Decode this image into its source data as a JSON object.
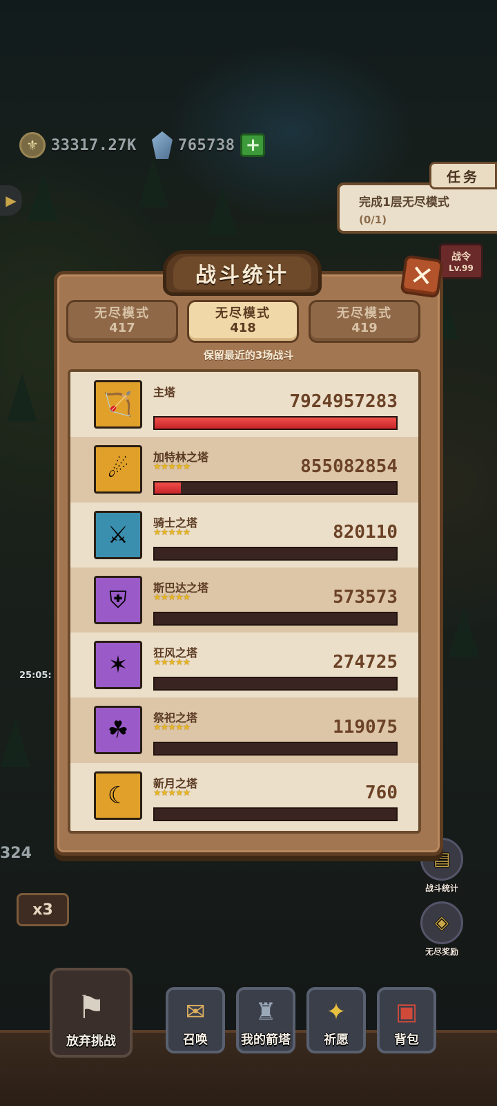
{
  "resources": {
    "gold_value": "33317.27K",
    "gem_value": "765738",
    "gold_icon": "coin-icon",
    "gem_icon": "gem-icon",
    "plus_label": "+"
  },
  "quest": {
    "tab_label": "任务",
    "title": "完成1层无尽模式",
    "progress": "(0/1)"
  },
  "battle_pass": {
    "label": "战令",
    "level": "Lv.99"
  },
  "modal": {
    "title": "战斗统计",
    "close_label": "✕",
    "note": "保留最近的3场战斗",
    "tabs": [
      {
        "name": "无尽模式",
        "number": "417",
        "active": false
      },
      {
        "name": "无尽模式",
        "number": "418",
        "active": true
      },
      {
        "name": "无尽模式",
        "number": "419",
        "active": false
      }
    ],
    "rows": [
      {
        "name": "主塔",
        "stars": "",
        "damage": "7924957283",
        "fill": 1.0,
        "portrait_color": "#e0a02a",
        "portrait_icon": "archer-portrait"
      },
      {
        "name": "加特林之塔",
        "stars": "★★★★★",
        "damage": "855082854",
        "fill": 0.108,
        "portrait_color": "#e0a02a",
        "portrait_icon": "gunner-portrait"
      },
      {
        "name": "骑士之塔",
        "stars": "★★★★★",
        "damage": "820110",
        "fill": 0.0,
        "portrait_color": "#3b8fae",
        "portrait_icon": "knight-portrait"
      },
      {
        "name": "斯巴达之塔",
        "stars": "★★★★★",
        "damage": "573573",
        "fill": 0.0,
        "portrait_color": "#9a5ac8",
        "portrait_icon": "spartan-portrait"
      },
      {
        "name": "狂风之塔",
        "stars": "★★★★★",
        "damage": "274725",
        "fill": 0.0,
        "portrait_color": "#9a5ac8",
        "portrait_icon": "harpy-portrait"
      },
      {
        "name": "祭祀之塔",
        "stars": "★★★★★",
        "damage": "119075",
        "fill": 0.0,
        "portrait_color": "#9a5ac8",
        "portrait_icon": "shaman-portrait"
      },
      {
        "name": "新月之塔",
        "stars": "★★★★★",
        "damage": "760",
        "fill": 0.0,
        "portrait_color": "#e0a02a",
        "portrait_icon": "crescent-portrait"
      }
    ]
  },
  "side": {
    "stats_label": "战斗统计",
    "reward_label": "无尽奖励",
    "speed_label": "x3",
    "timer": "25:05:",
    "left_number": "324"
  },
  "bottom_nav": {
    "abandon": "放弃挑战",
    "summon": "召唤",
    "my_towers": "我的箭塔",
    "pray": "祈愿",
    "backpack": "背包"
  }
}
